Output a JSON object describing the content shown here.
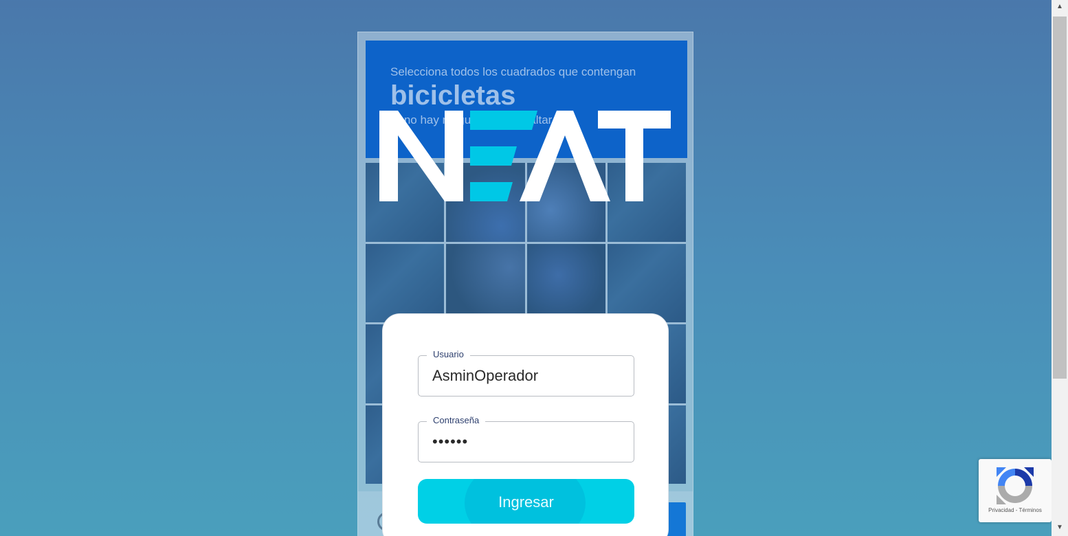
{
  "captcha": {
    "instruction": "Selecciona todos los cuadrados que contengan",
    "target_word": "bicicletas",
    "skip_hint": "Si no hay ninguna, pulsa Saltar"
  },
  "logo": {
    "text": "NEAT",
    "accent_color": "#00c8e6"
  },
  "login": {
    "user_label": "Usuario",
    "user_value": "AsminOperador",
    "password_label": "Contraseña",
    "password_value": "••••••",
    "submit_label": "Ingresar",
    "accent_color": "#00d0e6"
  },
  "recaptcha": {
    "links": "Privacidad - Términos",
    "icon": "recaptcha-logo-icon"
  },
  "scrollbar": {
    "up_icon": "▲",
    "down_icon": "▼"
  }
}
